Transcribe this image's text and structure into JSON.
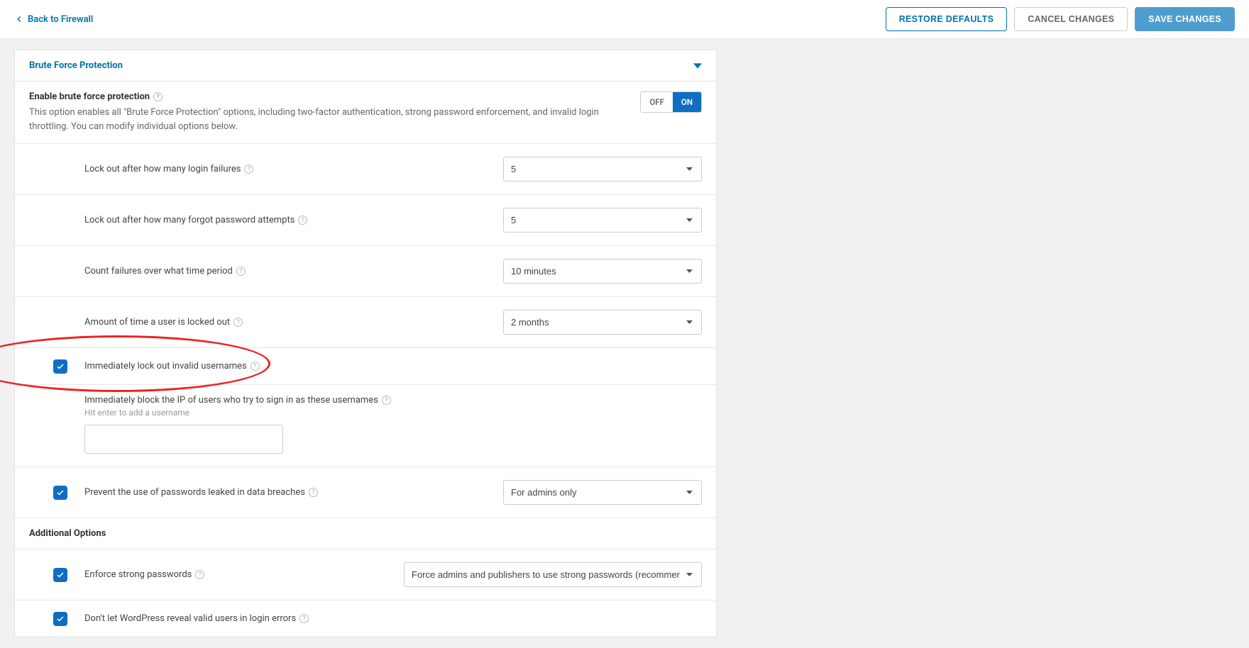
{
  "header": {
    "back_label": "Back to Firewall",
    "restore_label": "RESTORE DEFAULTS",
    "cancel_label": "CANCEL CHANGES",
    "save_label": "SAVE CHANGES"
  },
  "panel": {
    "title": "Brute Force Protection"
  },
  "enable_row": {
    "title": "Enable brute force protection",
    "description": "This option enables all \"Brute Force Protection\" options, including two-factor authentication, strong password enforcement, and invalid login throttling. You can modify individual options below.",
    "off": "OFF",
    "on": "ON"
  },
  "options": {
    "lockout_failures": {
      "label": "Lock out after how many login failures",
      "value": "5"
    },
    "lockout_forgot": {
      "label": "Lock out after how many forgot password attempts",
      "value": "5"
    },
    "count_period": {
      "label": "Count failures over what time period",
      "value": "10 minutes"
    },
    "lockout_duration": {
      "label": "Amount of time a user is locked out",
      "value": "2 months"
    },
    "lockout_invalid": {
      "label": "Immediately lock out invalid usernames"
    },
    "block_ip_users": {
      "label": "Immediately block the IP of users who try to sign in as these usernames",
      "hint": "Hit enter to add a username"
    },
    "leaked_passwords": {
      "label": "Prevent the use of passwords leaked in data breaches",
      "value": "For admins only"
    }
  },
  "additional": {
    "title": "Additional Options",
    "enforce_strong": {
      "label": "Enforce strong passwords",
      "value": "Force admins and publishers to use strong passwords (recommended)"
    },
    "dont_reveal": {
      "label": "Don't let WordPress reveal valid users in login errors"
    }
  }
}
